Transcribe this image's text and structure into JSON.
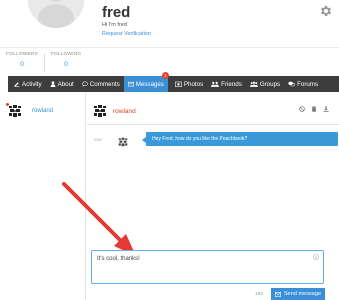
{
  "profile": {
    "name": "fred",
    "bio": "Hi I'm fred",
    "request_verification": "Request Verification"
  },
  "stats": {
    "followers_label": "FOLLOWERS",
    "followers_value": "0",
    "following_label": "FOLLOWING",
    "following_value": "0"
  },
  "nav": {
    "activity": "Activity",
    "about": "About",
    "comments": "Comments",
    "messages": "Messages",
    "messages_badge": "1",
    "photos": "Photos",
    "friends": "Friends",
    "groups": "Groups",
    "forums": "Forums"
  },
  "conversations": {
    "items": [
      {
        "name": "rowland"
      }
    ]
  },
  "thread": {
    "recipient": "rowland",
    "messages": [
      {
        "text": "Hey Fred, how do you like the Peachbook?",
        "time": "now"
      }
    ]
  },
  "compose": {
    "value": "It's cool, thanks!",
    "char_count": "182",
    "send_label": "Send message"
  },
  "colors": {
    "accent": "#3a8fd6",
    "navbar": "#3d3d3d",
    "highlight": "#e5412d"
  }
}
